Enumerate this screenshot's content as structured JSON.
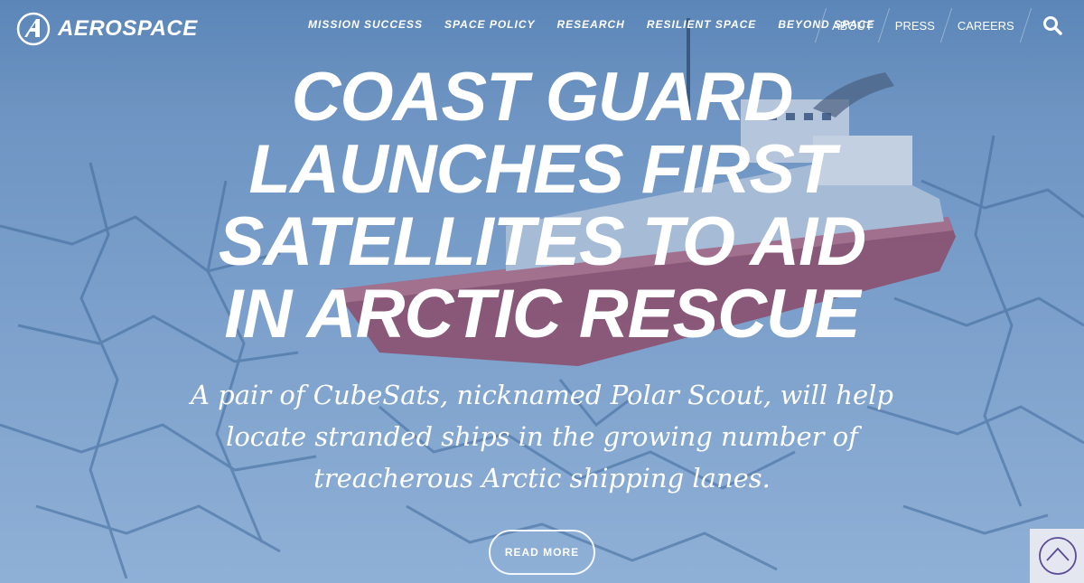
{
  "brand": {
    "name": "AEROSPACE"
  },
  "nav": {
    "primary": [
      "MISSION SUCCESS",
      "SPACE POLICY",
      "RESEARCH",
      "RESILIENT SPACE",
      "BEYOND SPACE"
    ],
    "secondary": [
      "ABOUT",
      "PRESS",
      "CAREERS"
    ]
  },
  "hero": {
    "headline": "COAST GUARD LAUNCHES FIRST SATELLITES TO AID IN ARCTIC RESCUE",
    "subtitle": "A pair of CubeSats, nicknamed Polar Scout, will help locate stranded ships in the growing number of treacherous Arctic shipping lanes.",
    "cta_label": "READ MORE"
  },
  "colors": {
    "overlay": "#3d6a9e",
    "scroll_button_bg": "#e4e7ef",
    "scroll_icon": "#5a4a9a"
  },
  "icons": {
    "logo": "aerospace-logo-icon",
    "search": "search-icon",
    "scroll_top": "chevron-up-circle-icon"
  }
}
